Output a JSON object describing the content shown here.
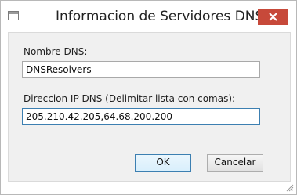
{
  "window": {
    "title": "Informacion de Servidores DNS",
    "close_icon": "close-icon",
    "accent": "#c7493a"
  },
  "form": {
    "name_label": "Nombre DNS:",
    "name_value": "DNSResolvers",
    "ip_label": "Direccion IP DNS (Delimitar lista con comas):",
    "ip_value": "205.210.42.205,64.68.200.200"
  },
  "buttons": {
    "ok_label": "OK",
    "cancel_label": "Cancelar"
  }
}
